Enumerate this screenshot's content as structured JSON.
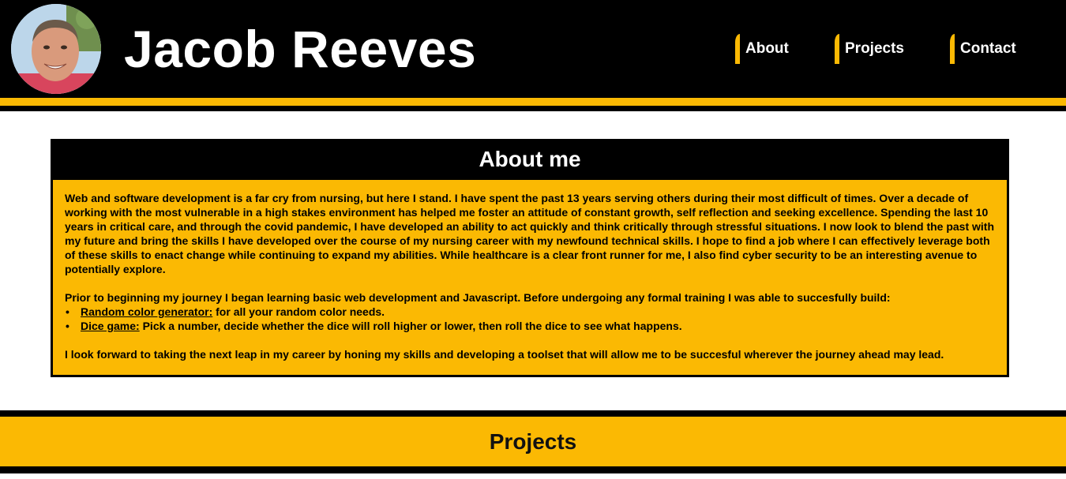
{
  "header": {
    "name": "Jacob Reeves",
    "nav": [
      {
        "label": "About"
      },
      {
        "label": "Projects"
      },
      {
        "label": "Contact"
      }
    ]
  },
  "about": {
    "heading": "About me",
    "paragraph1": "Web and software development is a far cry from nursing, but here I stand. I have spent the past 13 years serving others during their most difficult of times. Over a decade of working with the most vulnerable in a high stakes environment has helped me foster an attitude of constant growth, self reflection and seeking excellence. Spending the last 10 years in critical care, and through the covid pandemic, I have developed an ability to act quickly and think critically through stressful situations. I now look to blend the past with my future and bring the skills I have developed over the course of my nursing career with my newfound technical skills. I hope to find a job where I can effectively leverage both of these skills to enact change while continuing to expand my abilities. While healthcare is a clear front runner for me, I also find cyber security to be an interesting avenue to potentially explore.",
    "paragraph2": "Prior to beginning my journey I began learning basic web development and Javascript. Before undergoing any formal training I was able to succesfully build:",
    "projects": [
      {
        "link": "Random color generator:",
        "desc": " for all your random color needs."
      },
      {
        "link": "Dice game:",
        "desc": " Pick a number, decide whether the dice will roll higher or lower, then roll the dice to see what happens."
      }
    ],
    "paragraph3": "I look forward to taking the next leap in my career by honing my skills and developing a toolset that will allow me to be succesful wherever the journey ahead may lead."
  },
  "projects_section": {
    "heading": "Projects"
  },
  "colors": {
    "accent": "#fbb903",
    "background": "#000000",
    "text": "#ffffff"
  }
}
